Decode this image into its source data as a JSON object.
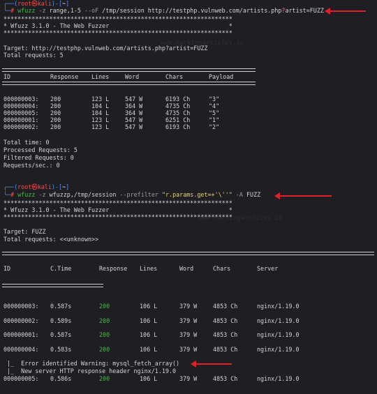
{
  "prompt_user": "root",
  "prompt_host": "kali",
  "prompt_dir": "~",
  "prompt_at": "㉿",
  "cmd1": {
    "bin": "wfuzz",
    "opt_z": "-z",
    "payload": "range,1-5",
    "opt_o": "--oF",
    "rest_before": "/tmp/session http://testphp.vulnweb.com/artists.php",
    "qmark": "?",
    "rest_after": "artist=FUZZ"
  },
  "stars": "*****************************************************************",
  "banner": "* Wfuzz 3.1.0 - The Web Fuzzer                                  *",
  "run1": {
    "target": "Target: http://testphp.vulnweb.com/artists.php?artist=FUZZ",
    "total": "Total requests: 5",
    "headers": [
      "ID",
      "Response",
      "Lines",
      "Word",
      "Chars",
      "Payload"
    ],
    "rows": [
      [
        "000000003:",
        "200",
        "123 L",
        "547 W",
        "6193 Ch",
        "\"3\""
      ],
      [
        "000000004:",
        "200",
        "104 L",
        "364 W",
        "4735 Ch",
        "\"4\""
      ],
      [
        "000000005:",
        "200",
        "104 L",
        "364 W",
        "4735 Ch",
        "\"5\""
      ],
      [
        "000000001:",
        "200",
        "123 L",
        "547 W",
        "6251 Ch",
        "\"1\""
      ],
      [
        "000000002:",
        "200",
        "123 L",
        "547 W",
        "6193 Ch",
        "\"2\""
      ]
    ],
    "summary": [
      "Total time: 0",
      "Processed Requests: 5",
      "Filtered Requests: 0",
      "Requests/sec.: 0"
    ]
  },
  "cmd2": {
    "bin": "wfuzz",
    "opt_z": "-z",
    "payload": "wfuzzp,/tmp/session",
    "opt_pref": "--prefilter",
    "filter": "\"r.params.get=+'\\''\"",
    "opt_a": "-A",
    "fuzz": "FUZZ"
  },
  "run2": {
    "target": "Target: FUZZ",
    "total": "Total requests: <<unknown>>",
    "headers": [
      "ID",
      "C.Time",
      "Response",
      "Lines",
      "Word",
      "Chars",
      "Server"
    ],
    "rows": [
      [
        "000000003:",
        "0.587s",
        "200",
        "106 L",
        "379 W",
        "4853 Ch",
        "nginx/1.19.0"
      ],
      [
        "000000002:",
        "0.589s",
        "200",
        "106 L",
        "379 W",
        "4853 Ch",
        "nginx/1.19.0"
      ],
      [
        "000000001:",
        "0.587s",
        "200",
        "106 L",
        "379 W",
        "4853 Ch",
        "nginx/1.19.0"
      ],
      [
        "000000004:",
        "0.583s",
        "200",
        "106 L",
        "379 W",
        "4853 Ch",
        "nginx/1.19.0"
      ]
    ],
    "notes": [
      "|_  Error identified Warning: mysql_fetch_array()",
      "|_  New server HTTP response header nginx/1.19.0"
    ],
    "last_row": [
      "000000005:",
      "0.586s",
      "200",
      "106 L",
      "379 W",
      "4853 Ch",
      "nginx/1.19.0"
    ]
  },
  "watermark": "www.hackingarticles.in",
  "colors": {
    "background": "#1f1f23",
    "prompt_blue": "#4f8ff7",
    "prompt_red": "#ff4a4a",
    "status_green": "#3fbf3f",
    "string_yellow": "#e8d36a",
    "arrow_red": "#e0202a"
  }
}
